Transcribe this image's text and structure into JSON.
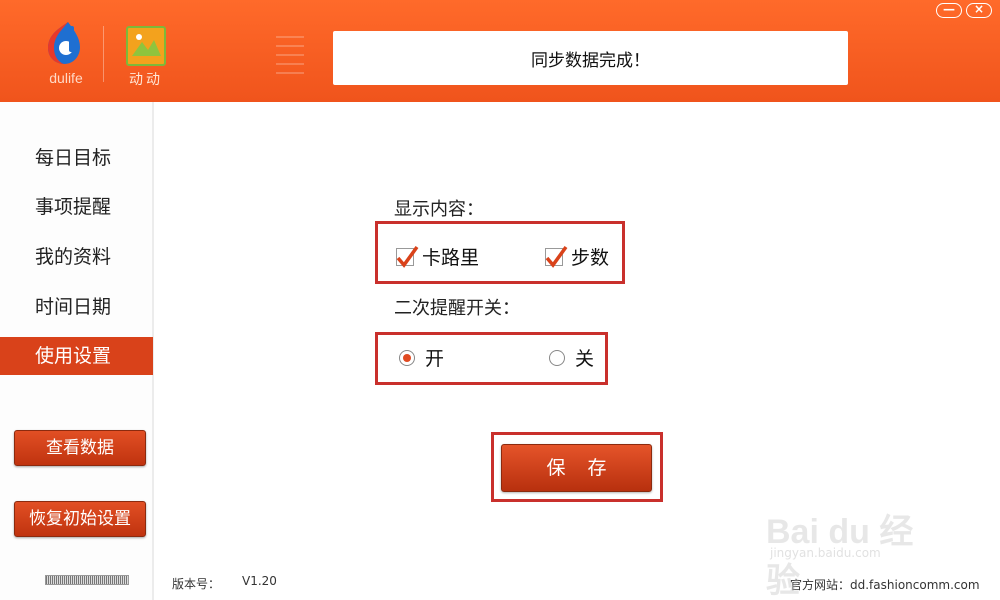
{
  "header": {
    "app_logo_text": "dulife",
    "secondary_logo_text": "动动",
    "status_message": "同步数据完成！",
    "window_controls": {
      "minimize": "—",
      "close": "×"
    }
  },
  "sidebar": {
    "items": [
      {
        "label": "每日目标"
      },
      {
        "label": "事项提醒"
      },
      {
        "label": "我的资料"
      },
      {
        "label": "时间日期"
      },
      {
        "label": "使用设置",
        "active": true
      }
    ],
    "view_data_button": "查看数据",
    "restore_defaults_button": "恢复初始设置"
  },
  "settings": {
    "display_content_label": "显示内容：",
    "display_options": [
      {
        "label": "卡路里",
        "checked": true
      },
      {
        "label": "步数",
        "checked": true
      }
    ],
    "reminder_label": "二次提醒开关：",
    "reminder_options": [
      {
        "label": "开",
        "selected": true
      },
      {
        "label": "关",
        "selected": false
      }
    ],
    "save_button": "保 存"
  },
  "footer": {
    "version_label": "版本号：",
    "version_value": "V1.20",
    "website_label": "官方网站：dd.fashioncomm.com"
  },
  "watermark": {
    "brand": "Bai du 经验",
    "url": "jingyan.baidu.com"
  },
  "colors": {
    "accent": "#f0541c",
    "active_nav": "#d9421a",
    "frame": "#c9302c"
  }
}
